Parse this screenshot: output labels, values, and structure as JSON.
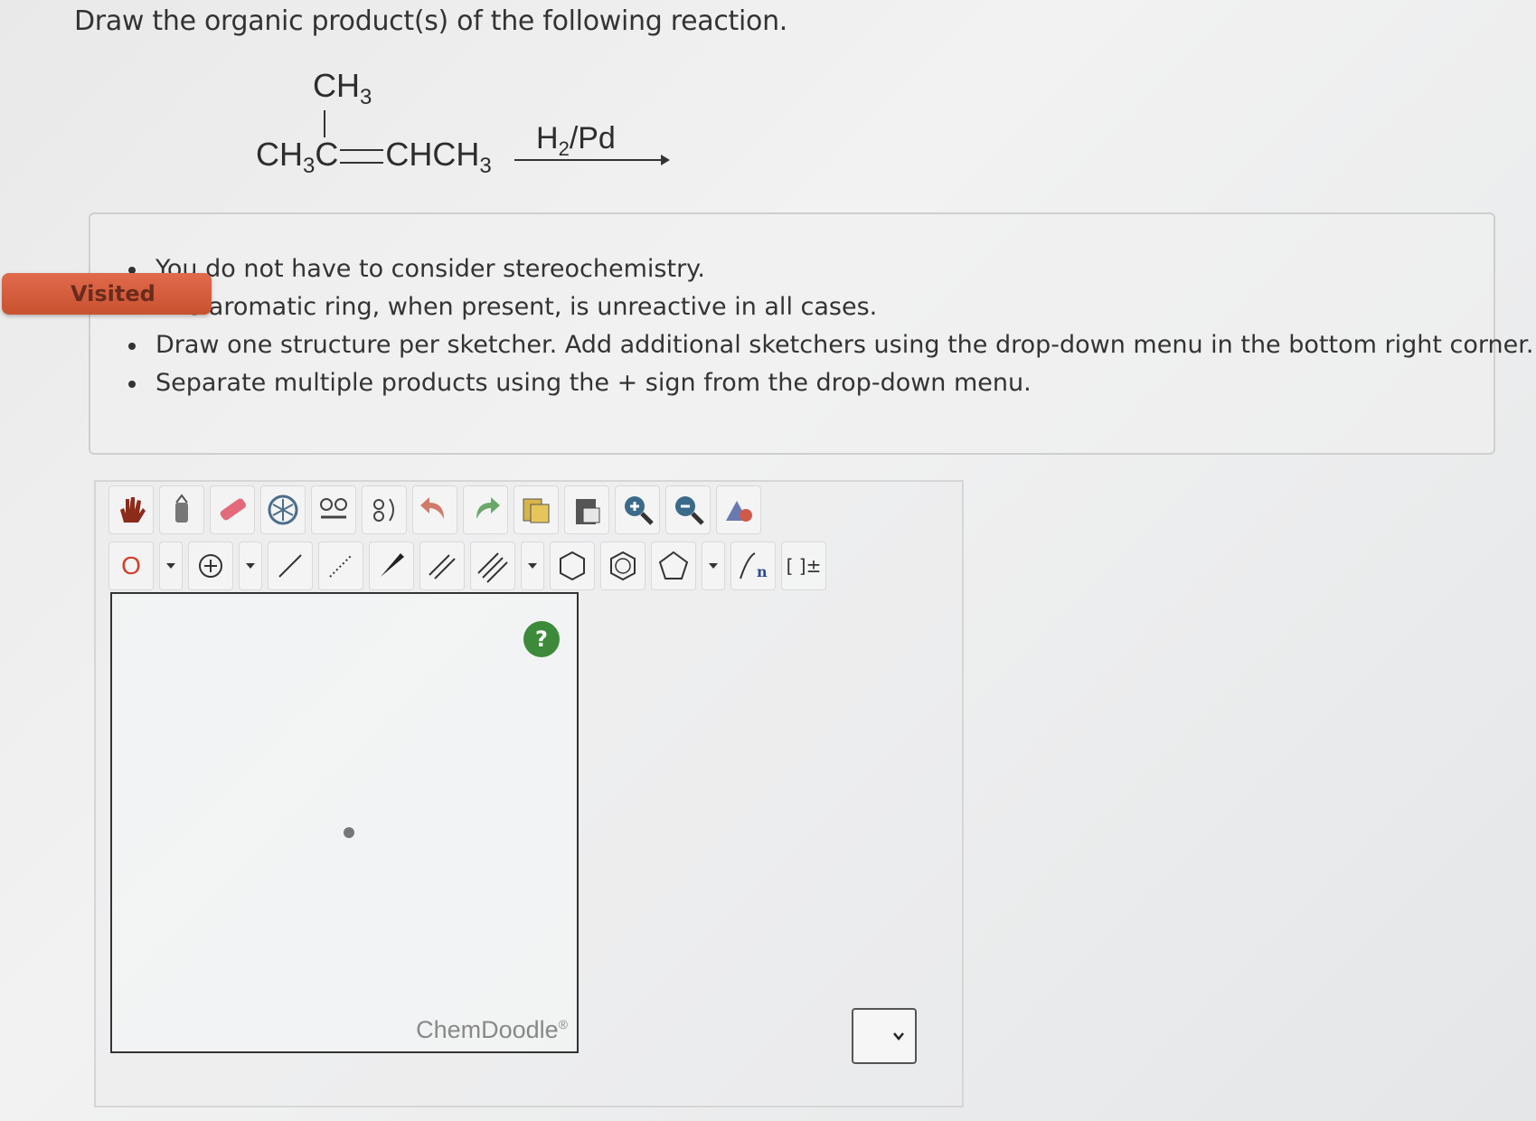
{
  "question": "Draw the organic product(s) of the following reaction.",
  "reaction": {
    "top_group": "CH3",
    "left_part": "CH3C",
    "right_part": "CHCH3",
    "reagent": "H2/Pd"
  },
  "badge": "Visited",
  "notes": [
    "You do not have to consider stereochemistry.",
    "The aromatic ring, when present, is unreactive in all cases.",
    "Draw one structure per sketcher. Add additional sketchers using the drop-down menu in the bottom right corner.",
    "Separate multiple products using the + sign from the drop-down menu."
  ],
  "toolbar": {
    "atom_label": "O",
    "help_label": "?",
    "bracket_label": "[ ]±"
  },
  "brand": "ChemDoodle",
  "brand_mark": "®"
}
